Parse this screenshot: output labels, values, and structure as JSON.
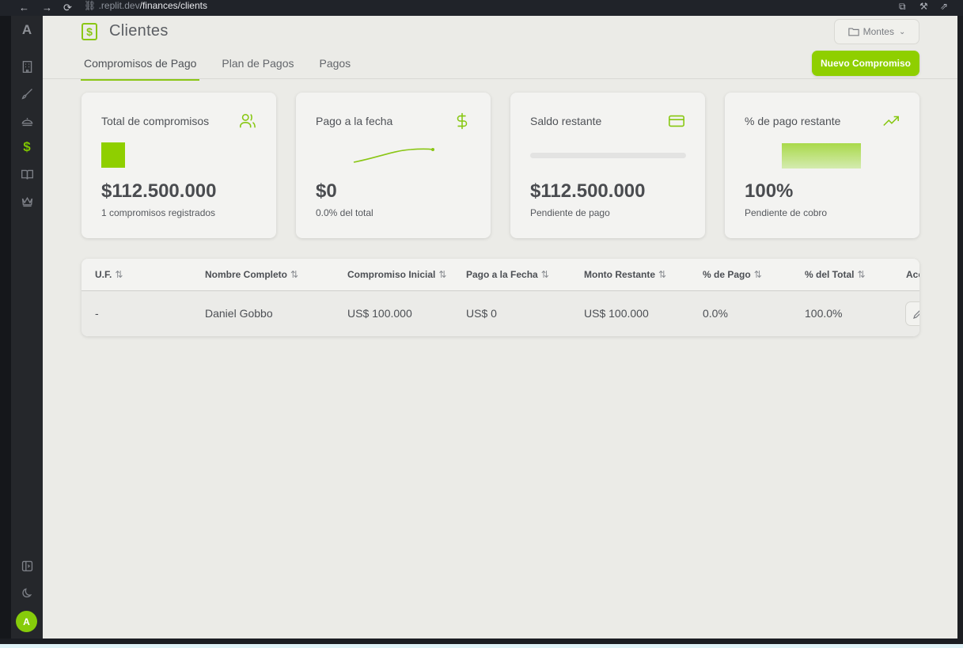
{
  "browser": {
    "url_prefix": ".replit.dev",
    "url_path": "/finances/clients"
  },
  "sidebar": {
    "logo": "A",
    "items": [
      "building-icon",
      "brush-icon",
      "cloche-icon",
      "dollar-icon",
      "book-icon",
      "crown-icon"
    ],
    "active_symbol": "$",
    "avatar_initial": "A"
  },
  "header": {
    "title": "Clientes",
    "folder_label": "Montes"
  },
  "tabs": [
    {
      "label": "Compromisos de Pago",
      "active": true
    },
    {
      "label": "Plan de Pagos",
      "active": false
    },
    {
      "label": "Pagos",
      "active": false
    }
  ],
  "new_button": "Nuevo Compromiso",
  "cards": [
    {
      "title": "Total de compromisos",
      "value": "$112.500.000",
      "sub": "1 compromisos registrados",
      "icon": "users-icon"
    },
    {
      "title": "Pago a la fecha",
      "value": "$0",
      "sub": "0.0% del total",
      "icon": "dollar-icon"
    },
    {
      "title": "Saldo restante",
      "value": "$112.500.000",
      "sub": "Pendiente de pago",
      "icon": "credit-card-icon",
      "progress": 0
    },
    {
      "title": "% de pago restante",
      "value": "100%",
      "sub": "Pendiente de cobro",
      "icon": "trending-up-icon"
    }
  ],
  "table": {
    "columns": [
      "U.F.",
      "Nombre Completo",
      "Compromiso Inicial",
      "Pago a la Fecha",
      "Monto Restante",
      "% de Pago",
      "% del Total",
      "Acciones"
    ],
    "sort_glyph": "⇅",
    "rows": [
      {
        "uf": "-",
        "nombre": "Daniel Gobbo",
        "compromiso": "US$ 100.000",
        "pago": "US$ 0",
        "restante": "US$ 100.000",
        "pct_pago": "0.0%",
        "pct_total": "100.0%"
      }
    ]
  },
  "colors": {
    "accent": "#8fcf00",
    "background": "#ebebe7",
    "sidebar": "#25272b"
  }
}
